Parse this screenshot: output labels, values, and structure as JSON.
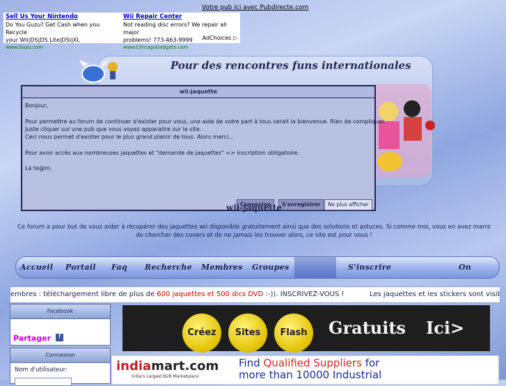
{
  "top_link": "Votre pub ici avec Pubdirecte.com",
  "ad_top": {
    "col1": {
      "title": "Sell Us Your Nintendo",
      "lines": [
        "Do You Guzu? Get Cash when you Recycle",
        "your Wii|DS|DS Lite|DSi|XL"
      ],
      "url": "www.Guzu.com"
    },
    "col2": {
      "title": "Wii Repair Center",
      "lines": [
        "Not reading disc errors? We repair all major",
        "problems! 773-463-9999"
      ],
      "url": "www.ChicagoGadgets.com"
    },
    "adchoices": "AdChoices"
  },
  "banner": {
    "title": "Pour des rencontres funs internationales"
  },
  "modal": {
    "title": "wii-jaquette",
    "body": "Bonjour,\n\nPour permettre au forum de continuer d'exister pour vous, une aide de votre part à tous serait la bienvenue. Rien de compliquer.\nJuste cliquer sur une pub que vous voyez apparaitre sur le site.\nCeci nous permet d'exister pour le plus grand plaisir de tous. Alors merci...\n\nPour avoir accès aux nombreuses jaquettes et \"demande de jaquettes\" => inscription obligatoire.\n\nLa te@m,",
    "btn_connexion": "Connexion",
    "btn_register": "S'enregistrer",
    "btn_hide": "Ne plus afficher"
  },
  "site_name": "wii-jaquette",
  "description": "Ce forum a pour but de vous aider à récupérer des jaquettes wii disponible gratuitement ainsi que des solutions et astuces. Si comme moi, vous en avez marre de chercher des covers et de ne jamais les trouver alors, ce site est pour vous !",
  "nav": {
    "items": [
      "Accueil",
      "Portail",
      "Faq",
      "Recherche",
      "Membres",
      "Groupes",
      "S'inscrire",
      "On"
    ]
  },
  "marquee": {
    "before": "embres : téléchargement libre de plus de ",
    "link": "600 jaquettes et 500 dics DVD",
    "after": " :-)). INSCRIVEZ-VOUS !",
    "right": "Les jaquettes et les stickers sont visible u"
  },
  "sidebar": {
    "facebook_title": "Facebook",
    "share_label": "Partager",
    "connexion_title": "Connexion",
    "username_label": "Nom d'utilisateur:"
  },
  "ad_banner": {
    "words": [
      "Créez",
      "Sites",
      "Flash"
    ],
    "gratuits": "Gratuits",
    "ici": "Ici>"
  },
  "ad_indiamart": {
    "logo_a": "india",
    "logo_b": "mart.com",
    "tagline": "India's Largest B2B Marketplace",
    "find": "Find ",
    "highlight": "Qualified Suppliers",
    "find2": " for",
    "more": "more than 10000 Industrial"
  }
}
